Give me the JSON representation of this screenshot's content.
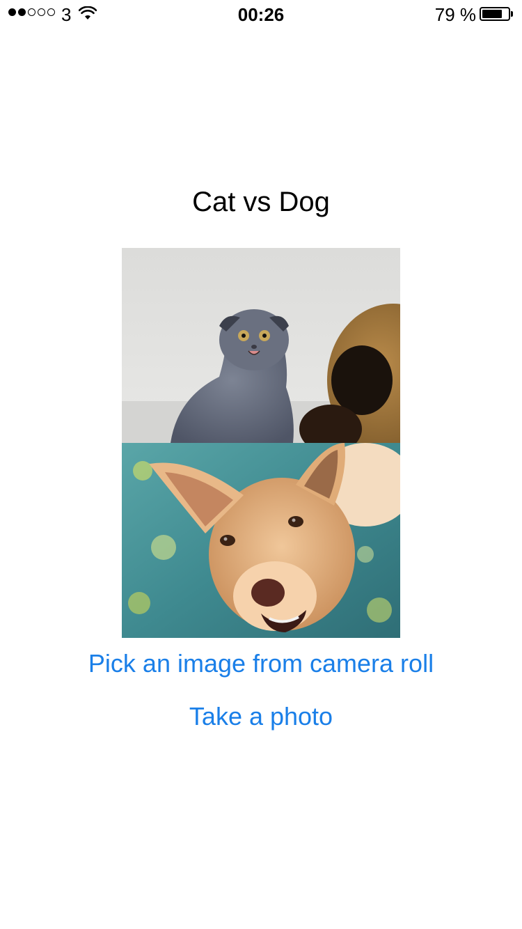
{
  "status_bar": {
    "carrier": "3",
    "signal_bars_filled": 2,
    "signal_bars_total": 5,
    "time": "00:26",
    "battery_percent_text": "79 %",
    "battery_level": 0.79
  },
  "main": {
    "title": "Cat vs Dog",
    "images": {
      "top": "cat-photo",
      "bottom": "dog-photo"
    },
    "actions": {
      "pick_from_camera_roll": "Pick an image from camera roll",
      "take_photo": "Take a photo"
    }
  },
  "colors": {
    "link": "#1a7fe8",
    "text": "#000000",
    "background": "#ffffff"
  }
}
